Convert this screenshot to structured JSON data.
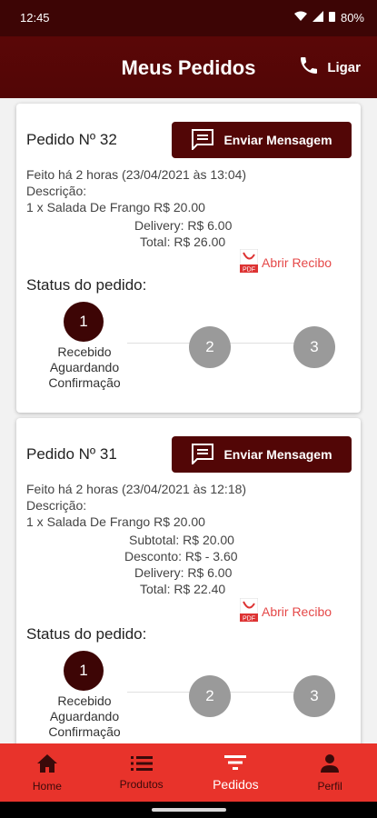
{
  "status_bar": {
    "time": "12:45",
    "battery": "80%"
  },
  "app_bar": {
    "title": "Meus Pedidos",
    "call_label": "Ligar"
  },
  "orders": [
    {
      "title": "Pedido Nº 32",
      "message_button": "Enviar Mensagem",
      "placed": "Feito há 2 horas  (23/04/2021 às 13:04)",
      "description_label": "Descrição:",
      "item": "1 x  Salada De Frango R$ 20.00",
      "delivery": "Delivery: R$ 6.00",
      "total": "Total: R$ 26.00",
      "receipt_link": "Abrir Recibo",
      "status_label": "Status do pedido:",
      "steps": [
        "1",
        "2",
        "3"
      ],
      "step_caption": "Recebido\nAguardando\nConfirmação"
    },
    {
      "title": "Pedido Nº 31",
      "message_button": "Enviar Mensagem",
      "placed": "Feito há 2 horas  (23/04/2021 às 12:18)",
      "description_label": "Descrição:",
      "item": "1 x  Salada De Frango R$ 20.00",
      "subtotal": "Subtotal: R$ 20.00",
      "discount": "Desconto: R$ - 3.60",
      "delivery": "Delivery: R$ 6.00",
      "total": "Total: R$ 22.40",
      "receipt_link": "Abrir Recibo",
      "status_label": "Status do pedido:",
      "steps": [
        "1",
        "2",
        "3"
      ],
      "step_caption": "Recebido\nAguardando\nConfirmação"
    }
  ],
  "bottom_nav": [
    {
      "label": "Home",
      "icon": "home-icon"
    },
    {
      "label": "Produtos",
      "icon": "list-icon"
    },
    {
      "label": "Pedidos",
      "icon": "filter-icon",
      "active": true
    },
    {
      "label": "Perfil",
      "icon": "person-icon"
    }
  ],
  "colors": {
    "primary": "#520606",
    "nav": "#e8332b",
    "link": "#e54848",
    "step_inactive": "#9a9a9a"
  }
}
